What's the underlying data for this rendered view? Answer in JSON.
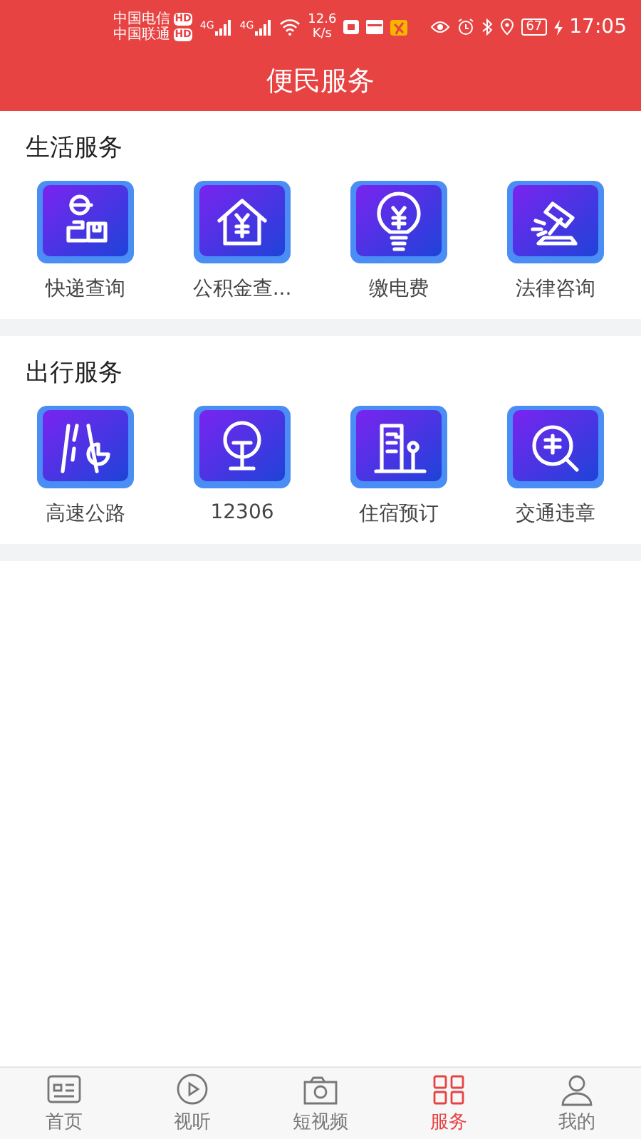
{
  "status_bar": {
    "carriers": [
      {
        "name": "中国电信",
        "badge": "HD"
      },
      {
        "name": "中国联通",
        "badge": "HD"
      }
    ],
    "networks": [
      "4G",
      "4G"
    ],
    "speed": "12.6",
    "speed_unit": "K/s",
    "battery": "67",
    "time": "17:05"
  },
  "header": {
    "title": "便民服务"
  },
  "sections": [
    {
      "title": "生活服务",
      "items": [
        {
          "kind": "courier",
          "label": "快递查询"
        },
        {
          "kind": "housing",
          "label": "公积金查..."
        },
        {
          "kind": "bulb",
          "label": "缴电费"
        },
        {
          "kind": "gavel",
          "label": "法律咨询"
        }
      ]
    },
    {
      "title": "出行服务",
      "items": [
        {
          "kind": "highway",
          "label": "高速公路"
        },
        {
          "kind": "train",
          "label": "12306"
        },
        {
          "kind": "hotel",
          "label": "住宿预订"
        },
        {
          "kind": "traffic",
          "label": "交通违章"
        }
      ]
    }
  ],
  "tabs": [
    {
      "kind": "news",
      "label": "首页",
      "selected": false
    },
    {
      "kind": "play",
      "label": "视听",
      "selected": false
    },
    {
      "kind": "camera",
      "label": "短视频",
      "selected": false
    },
    {
      "kind": "grid",
      "label": "服务",
      "selected": true
    },
    {
      "kind": "person",
      "label": "我的",
      "selected": false
    }
  ]
}
